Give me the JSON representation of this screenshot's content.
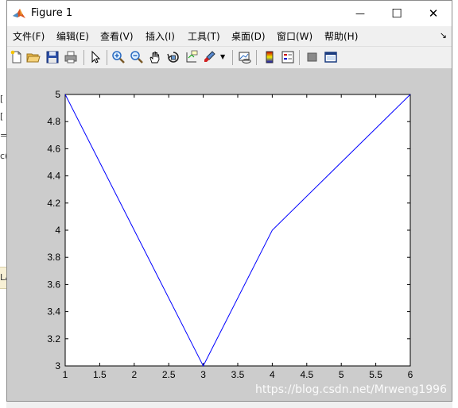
{
  "window": {
    "title": "Figure 1",
    "controls": {
      "minimize": "—",
      "maximize": "☐",
      "close": "✕"
    }
  },
  "menu": {
    "items": [
      "文件(F)",
      "编辑(E)",
      "查看(V)",
      "插入(I)",
      "工具(T)",
      "桌面(D)",
      "窗口(W)",
      "帮助(H)"
    ],
    "overflow": "↘"
  },
  "toolbar": {
    "icons": [
      "new-figure-icon",
      "open-file-icon",
      "save-icon",
      "print-icon",
      "pointer-icon",
      "zoom-in-icon",
      "zoom-out-icon",
      "pan-icon",
      "rotate-3d-icon",
      "data-cursor-icon",
      "brush-icon",
      "link-plot-icon",
      "colorbar-icon",
      "legend-icon",
      "hide-plot-tools-icon",
      "show-plot-tools-icon"
    ]
  },
  "background_fragments": [
    "[",
    "[",
    "=",
    "c(",
    "LA"
  ],
  "watermark": "https://blog.csdn.net/Mrweng1996",
  "colors": {
    "line": "#0000ff",
    "axes_bg": "#ffffff",
    "figure_bg": "#cccccc"
  },
  "chart_data": {
    "type": "line",
    "x": [
      1,
      2,
      3,
      4,
      5,
      6
    ],
    "series": [
      {
        "values": [
          5,
          4,
          3,
          4,
          4.5,
          5
        ]
      }
    ],
    "xlim": [
      1,
      6
    ],
    "ylim": [
      3,
      5
    ],
    "xticks": [
      "1",
      "1.5",
      "2",
      "2.5",
      "3",
      "3.5",
      "4",
      "4.5",
      "5",
      "5.5",
      "6"
    ],
    "yticks": [
      "3",
      "3.2",
      "3.4",
      "3.6",
      "3.8",
      "4",
      "4.2",
      "4.4",
      "4.6",
      "4.8",
      "5"
    ],
    "title": "",
    "xlabel": "",
    "ylabel": "",
    "grid": false
  }
}
